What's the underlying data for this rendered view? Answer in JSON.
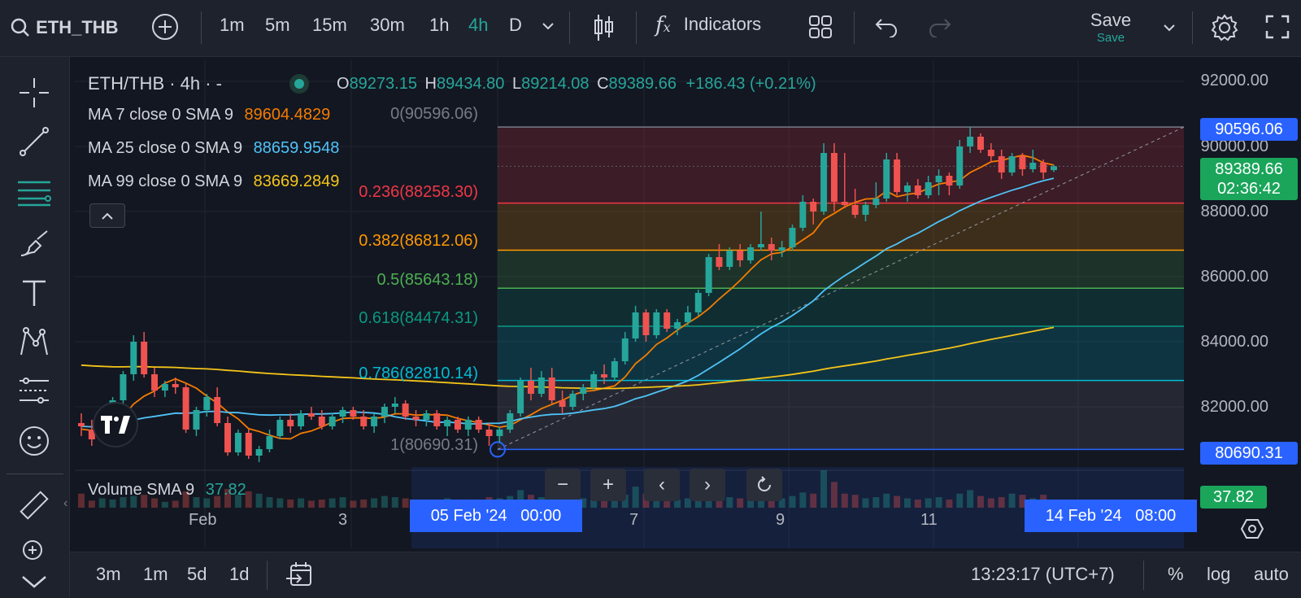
{
  "toolbar": {
    "symbol": "ETH_THB",
    "timeframes": [
      "1m",
      "5m",
      "15m",
      "30m",
      "1h",
      "4h",
      "D"
    ],
    "active_timeframe": "4h",
    "indicators_label": "Indicators",
    "save_label": "Save",
    "save_status": "Save"
  },
  "legend": {
    "title": "ETH/THB · 4h · -",
    "o_label": "O",
    "o": "89273.15",
    "h_label": "H",
    "h": "89434.80",
    "l_label": "L",
    "l": "89214.08",
    "c_label": "C",
    "c": "89389.66",
    "change": "+186.43 (+0.21%)",
    "ma7_label": "MA 7 close 0 SMA 9",
    "ma7": "89604.4829",
    "ma25_label": "MA 25 close 0 SMA 9",
    "ma25": "88659.9548",
    "ma99_label": "MA 99 close 0 SMA 9",
    "ma99": "83669.2849",
    "volume_label": "Volume SMA 9",
    "volume": "37.82"
  },
  "fib": {
    "levels": [
      {
        "label": "0(90596.06)",
        "color": "#787b86"
      },
      {
        "label": "0.236(88258.30)",
        "color": "#f23645"
      },
      {
        "label": "0.382(86812.06)",
        "color": "#ff9800"
      },
      {
        "label": "0.5(85643.18)",
        "color": "#4caf50"
      },
      {
        "label": "0.618(84474.31)",
        "color": "#089981"
      },
      {
        "label": "0.786(82810.14)",
        "color": "#00bcd4"
      },
      {
        "label": "1(80690.31)",
        "color": "#787b86"
      }
    ]
  },
  "price_scale": {
    "ticks": [
      "92000.00",
      "90000.00",
      "88000.00",
      "86000.00",
      "84000.00",
      "82000.00"
    ],
    "fib_top": "90596.06",
    "last_price": "89389.66",
    "countdown": "02:36:42",
    "fib_bottom": "80690.31",
    "volume_value": "37.82"
  },
  "time_axis": {
    "labels": [
      "Feb",
      "3",
      "7",
      "9",
      "11"
    ],
    "range_start": "05 Feb '24   00:00",
    "range_end": "14 Feb '24   08:00"
  },
  "bottom": {
    "ranges": [
      "3m",
      "1m",
      "5d",
      "1d"
    ],
    "clock": "13:23:17 (UTC+7)",
    "percent": "%",
    "log": "log",
    "auto": "auto"
  },
  "colors": {
    "up": "#26a69a",
    "down": "#ef5350",
    "ma7": "#f57c00",
    "ma25": "#4fc3f7",
    "ma99": "#f5c518",
    "accent_blue": "#2962ff",
    "accent_green": "#1aa55a"
  },
  "chart_data": {
    "type": "candlestick",
    "ylim": [
      80000,
      92500
    ],
    "candles": [
      [
        81500,
        81800,
        81100,
        81400
      ],
      [
        81300,
        81600,
        80800,
        81000
      ],
      [
        81000,
        81900,
        80900,
        81700
      ],
      [
        81700,
        82300,
        81500,
        82200
      ],
      [
        82200,
        83100,
        82000,
        83000
      ],
      [
        83000,
        84200,
        82800,
        84000
      ],
      [
        84000,
        84300,
        82900,
        83000
      ],
      [
        83000,
        83200,
        82300,
        82500
      ],
      [
        82500,
        82800,
        82300,
        82700
      ],
      [
        82700,
        82900,
        82400,
        82600
      ],
      [
        82600,
        82700,
        81200,
        81300
      ],
      [
        81300,
        82000,
        81100,
        81900
      ],
      [
        81900,
        82400,
        81700,
        82300
      ],
      [
        82300,
        82600,
        81400,
        81500
      ],
      [
        81500,
        81700,
        80500,
        80600
      ],
      [
        80600,
        81300,
        80500,
        81200
      ],
      [
        81200,
        81300,
        80400,
        80500
      ],
      [
        80500,
        80800,
        80300,
        80700
      ],
      [
        80700,
        81300,
        80600,
        81100
      ],
      [
        81100,
        81700,
        81000,
        81600
      ],
      [
        81600,
        81800,
        81200,
        81400
      ],
      [
        81400,
        81900,
        81300,
        81800
      ],
      [
        81800,
        82000,
        81600,
        81700
      ],
      [
        81700,
        81900,
        81300,
        81400
      ],
      [
        81400,
        81800,
        81300,
        81700
      ],
      [
        81700,
        82000,
        81500,
        81900
      ],
      [
        81900,
        82000,
        81600,
        81700
      ],
      [
        81700,
        81900,
        81300,
        81400
      ],
      [
        81400,
        81800,
        81200,
        81700
      ],
      [
        81700,
        82100,
        81500,
        82000
      ],
      [
        82000,
        82300,
        81800,
        82100
      ],
      [
        82100,
        82200,
        81600,
        81700
      ],
      [
        81700,
        81900,
        81400,
        81600
      ],
      [
        81600,
        81900,
        81400,
        81800
      ],
      [
        81800,
        81900,
        81300,
        81400
      ],
      [
        81400,
        81700,
        81100,
        81600
      ],
      [
        81600,
        81700,
        81200,
        81300
      ],
      [
        81300,
        81700,
        81100,
        81600
      ],
      [
        81600,
        81700,
        81200,
        81300
      ],
      [
        81300,
        81500,
        80800,
        81100
      ],
      [
        81100,
        81400,
        80900,
        81300
      ],
      [
        81300,
        81900,
        81200,
        81800
      ],
      [
        81800,
        82900,
        81700,
        82800
      ],
      [
        82800,
        83200,
        82200,
        82400
      ],
      [
        82400,
        83100,
        82300,
        82900
      ],
      [
        82900,
        83200,
        82100,
        82200
      ],
      [
        82200,
        82500,
        81800,
        82000
      ],
      [
        82000,
        82500,
        81900,
        82400
      ],
      [
        82400,
        82700,
        82200,
        82600
      ],
      [
        82600,
        83100,
        82500,
        83000
      ],
      [
        83000,
        83300,
        82700,
        82900
      ],
      [
        82900,
        83500,
        82800,
        83400
      ],
      [
        83400,
        84300,
        83300,
        84100
      ],
      [
        84100,
        85100,
        84000,
        84900
      ],
      [
        84900,
        85000,
        84000,
        84200
      ],
      [
        84200,
        85000,
        84100,
        84900
      ],
      [
        84900,
        85000,
        84300,
        84400
      ],
      [
        84400,
        84700,
        84200,
        84600
      ],
      [
        84600,
        85100,
        84500,
        84900
      ],
      [
        84900,
        85600,
        84800,
        85500
      ],
      [
        85500,
        86700,
        85400,
        86600
      ],
      [
        86600,
        87000,
        86200,
        86300
      ],
      [
        86300,
        86900,
        86200,
        86800
      ],
      [
        86800,
        87000,
        86300,
        86500
      ],
      [
        86500,
        87000,
        86400,
        86900
      ],
      [
        86900,
        88000,
        86800,
        87000
      ],
      [
        87000,
        87200,
        86500,
        86800
      ],
      [
        86800,
        87100,
        86600,
        86900
      ],
      [
        86900,
        87600,
        86800,
        87500
      ],
      [
        87500,
        88500,
        87400,
        88300
      ],
      [
        88300,
        88400,
        87600,
        88000
      ],
      [
        88000,
        90100,
        87900,
        89800
      ],
      [
        89800,
        90100,
        88000,
        88300
      ],
      [
        88300,
        89800,
        88100,
        88200
      ],
      [
        88200,
        88700,
        87800,
        87900
      ],
      [
        87900,
        88300,
        87700,
        88200
      ],
      [
        88200,
        88900,
        88100,
        88400
      ],
      [
        88400,
        89800,
        88300,
        89600
      ],
      [
        89600,
        89800,
        88500,
        88600
      ],
      [
        88600,
        88900,
        88300,
        88800
      ],
      [
        88800,
        89000,
        88400,
        88500
      ],
      [
        88500,
        89100,
        88400,
        88900
      ],
      [
        88900,
        89300,
        88500,
        89100
      ],
      [
        89100,
        89200,
        88500,
        88800
      ],
      [
        88800,
        90200,
        88700,
        90000
      ],
      [
        90000,
        90600,
        89800,
        90300
      ],
      [
        90300,
        90400,
        89800,
        89900
      ],
      [
        89900,
        90100,
        89500,
        89700
      ],
      [
        89700,
        89900,
        89000,
        89200
      ],
      [
        89200,
        89800,
        89100,
        89700
      ],
      [
        89700,
        89800,
        89100,
        89300
      ],
      [
        89300,
        89900,
        89200,
        89500
      ],
      [
        89500,
        89600,
        89000,
        89200
      ],
      [
        89273,
        89435,
        89214,
        89390
      ]
    ],
    "volumes": [
      60,
      30,
      40,
      35,
      45,
      50,
      55,
      40,
      25,
      30,
      70,
      45,
      40,
      50,
      80,
      55,
      70,
      60,
      45,
      40,
      35,
      40,
      30,
      35,
      40,
      45,
      30,
      35,
      40,
      50,
      45,
      40,
      35,
      30,
      35,
      40,
      30,
      35,
      30,
      45,
      40,
      50,
      75,
      55,
      45,
      40,
      50,
      45,
      40,
      35,
      45,
      40,
      55,
      90,
      60,
      45,
      40,
      35,
      40,
      50,
      60,
      55,
      45,
      40,
      35,
      55,
      45,
      40,
      50,
      65,
      60,
      160,
      110,
      60,
      55,
      40,
      45,
      60,
      50,
      40,
      35,
      40,
      45,
      35,
      60,
      75,
      50,
      40,
      45,
      60,
      55,
      40,
      55,
      30
    ]
  }
}
